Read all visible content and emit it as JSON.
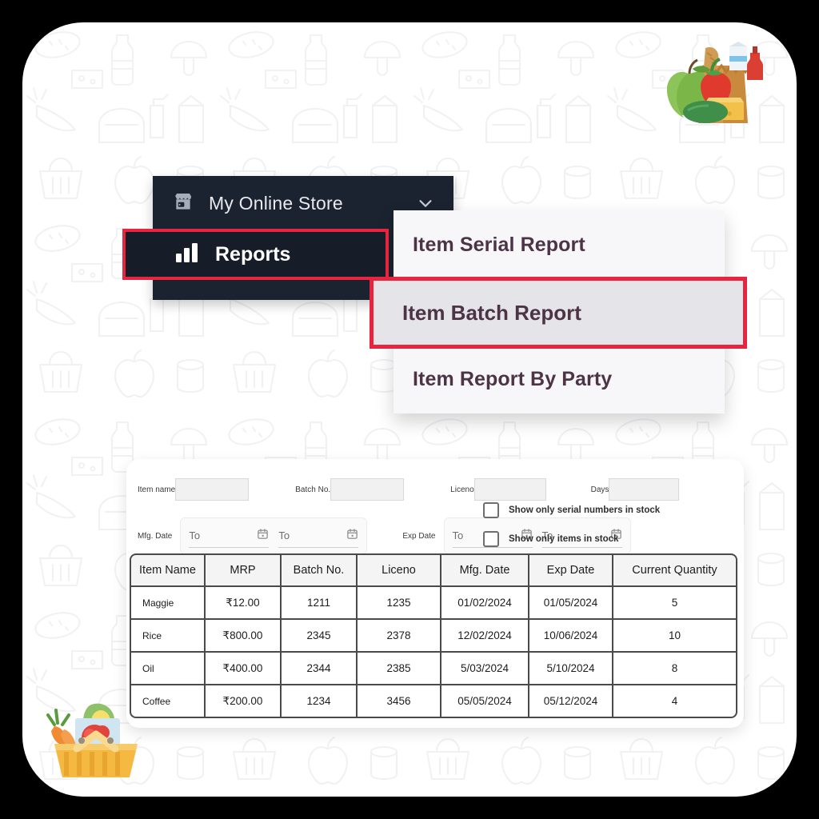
{
  "nav": {
    "store": {
      "label": "My Online Store",
      "icon": "storefront-icon",
      "chevron": "chevron-down-icon"
    },
    "reports": {
      "label": "Reports",
      "icon": "bar-chart-icon"
    },
    "panel_color": "#1b2330",
    "highlight_color": "#e8243f"
  },
  "dropdown": {
    "items": [
      {
        "label": "Item Serial Report",
        "selected": false
      },
      {
        "label": "Item Batch Report",
        "selected": true
      },
      {
        "label": "Item Report By Party",
        "selected": false
      }
    ],
    "selected_bg": "#e5e4e9",
    "text_color": "#4c3446"
  },
  "filters": {
    "text_fields": [
      {
        "label": "Item name",
        "value": "",
        "placeholder": ""
      },
      {
        "label": "Batch No.",
        "value": "",
        "placeholder": ""
      },
      {
        "label": "Liceno",
        "value": "",
        "placeholder": ""
      },
      {
        "label": "Days",
        "value": "",
        "placeholder": ""
      }
    ],
    "date_ranges": [
      {
        "label": "Mfg. Date",
        "from": {
          "placeholder": "To",
          "value": "",
          "icon": "calendar-icon"
        },
        "to": {
          "placeholder": "To",
          "value": "",
          "icon": "calendar-icon"
        }
      },
      {
        "label": "Exp Date",
        "from": {
          "placeholder": "To",
          "value": "",
          "icon": "calendar-icon"
        },
        "to": {
          "placeholder": "To",
          "value": "",
          "icon": "calendar-icon"
        }
      }
    ],
    "checkboxes": [
      {
        "label": "Show only serial numbers in stock",
        "checked": false
      },
      {
        "label": "Show only items in stock",
        "checked": false
      }
    ]
  },
  "table": {
    "columns": [
      "Item Name",
      "MRP",
      "Batch No.",
      "Liceno",
      "Mfg. Date",
      "Exp Date",
      "Current Quantity"
    ],
    "rows": [
      {
        "item": "Maggie",
        "mrp": "₹12.00",
        "batch": "1211",
        "liceno": "1235",
        "mfg": "01/02/2024",
        "exp": "01/05/2024",
        "qty": "5"
      },
      {
        "item": "Rice",
        "mrp": "₹800.00",
        "batch": "2345",
        "liceno": "2378",
        "mfg": "12/02/2024",
        "exp": "10/06/2024",
        "qty": "10"
      },
      {
        "item": "Oil",
        "mrp": "₹400.00",
        "batch": "2344",
        "liceno": "2385",
        "mfg": "5/03/2024",
        "exp": "5/10/2024",
        "qty": "8"
      },
      {
        "item": "Coffee",
        "mrp": "₹200.00",
        "batch": "1234",
        "liceno": "3456",
        "mfg": "05/05/2024",
        "exp": "05/12/2024",
        "qty": "4"
      }
    ]
  },
  "decorations": {
    "top_right": "grocery-bag-illustration",
    "bottom_left": "shopping-basket-illustration",
    "background": "grocery-doodle-pattern"
  }
}
